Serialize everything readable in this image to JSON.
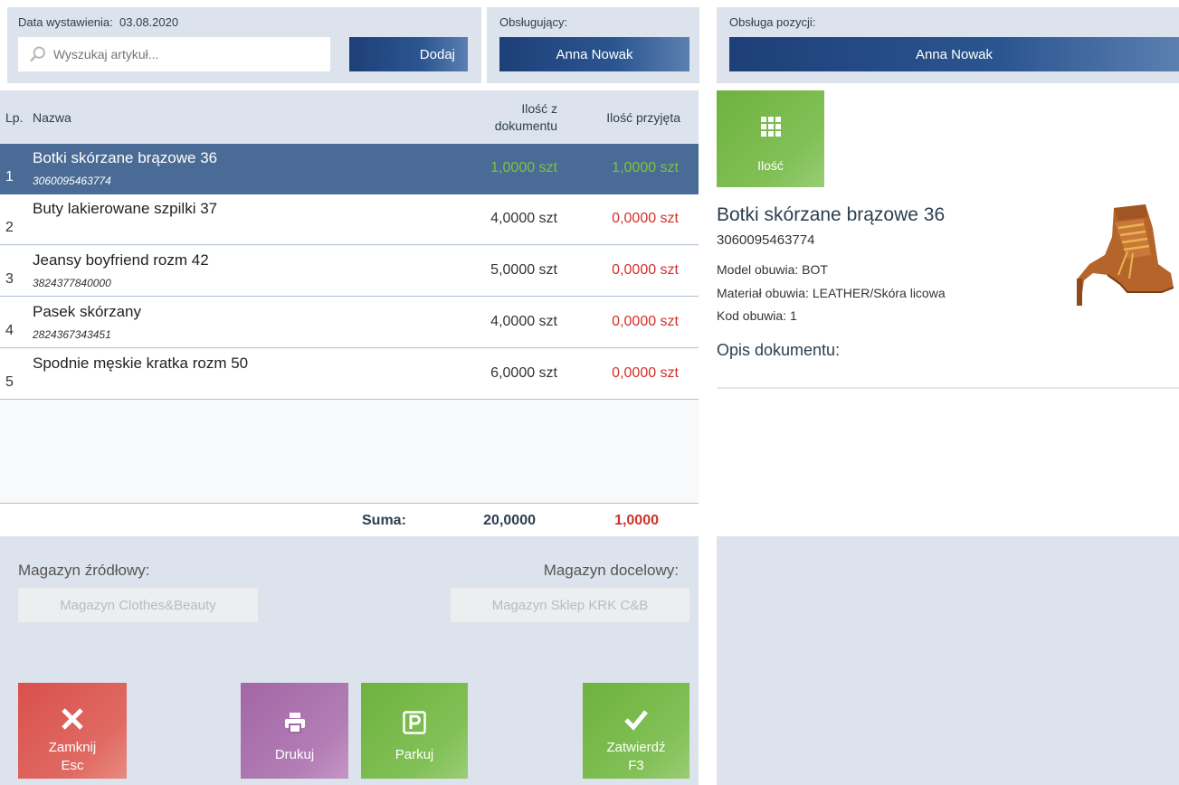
{
  "header": {
    "date_label": "Data wystawienia:",
    "date_value": "03.08.2020",
    "search_placeholder": "Wyszukaj artykuł...",
    "add_label": "Dodaj",
    "handler_label": "Obsługujący:",
    "handler_value": "Anna Nowak",
    "position_handler_label": "Obsługa pozycji:",
    "position_handler_value": "Anna Nowak"
  },
  "table": {
    "col_lp": "Lp.",
    "col_name": "Nazwa",
    "col_qty_doc_line1": "Ilość z",
    "col_qty_doc_line2": "dokumentu",
    "col_qty_recv": "Ilość przyjęta",
    "rows": [
      {
        "lp": "1",
        "name": "Botki skórzane brązowe 36",
        "code": "3060095463774",
        "qty_doc": "1,0000 szt",
        "qty_recv": "1,0000 szt",
        "selected": true
      },
      {
        "lp": "2",
        "name": "Buty lakierowane szpilki 37",
        "code": "",
        "qty_doc": "4,0000 szt",
        "qty_recv": "0,0000 szt"
      },
      {
        "lp": "3",
        "name": "Jeansy boyfriend rozm 42",
        "code": "3824377840000",
        "qty_doc": "5,0000 szt",
        "qty_recv": "0,0000 szt"
      },
      {
        "lp": "4",
        "name": "Pasek skórzany",
        "code": "2824367343451",
        "qty_doc": "4,0000 szt",
        "qty_recv": "0,0000 szt"
      },
      {
        "lp": "5",
        "name": "Spodnie męskie kratka rozm 50",
        "code": "",
        "qty_doc": "6,0000 szt",
        "qty_recv": "0,0000 szt"
      }
    ],
    "sum_label": "Suma:",
    "sum_doc": "20,0000",
    "sum_recv": "1,0000"
  },
  "warehouses": {
    "source_label": "Magazyn źródłowy:",
    "source_value": "Magazyn Clothes&Beauty",
    "target_label": "Magazyn docelowy:",
    "target_value": "Magazyn Sklep KRK C&B"
  },
  "buttons": {
    "close_line1": "Zamknij",
    "close_line2": "Esc",
    "print": "Drukuj",
    "park": "Parkuj",
    "confirm_line1": "Zatwierdź",
    "confirm_line2": "F3",
    "quantity": "Ilość"
  },
  "detail": {
    "name": "Botki skórzane brązowe 36",
    "code": "3060095463774",
    "model": "Model obuwia: BOT",
    "material": "Materiał obuwia: LEATHER/Skóra licowa",
    "shoe_code": "Kod obuwia: 1",
    "description_label": "Opis dokumentu:"
  },
  "colors": {
    "navy": "#1e3f78",
    "selected_row": "#4a6b95",
    "green": "#7cc243",
    "red": "#d0312d",
    "purple": "#a86aaa",
    "close_red": "#d9504c"
  }
}
